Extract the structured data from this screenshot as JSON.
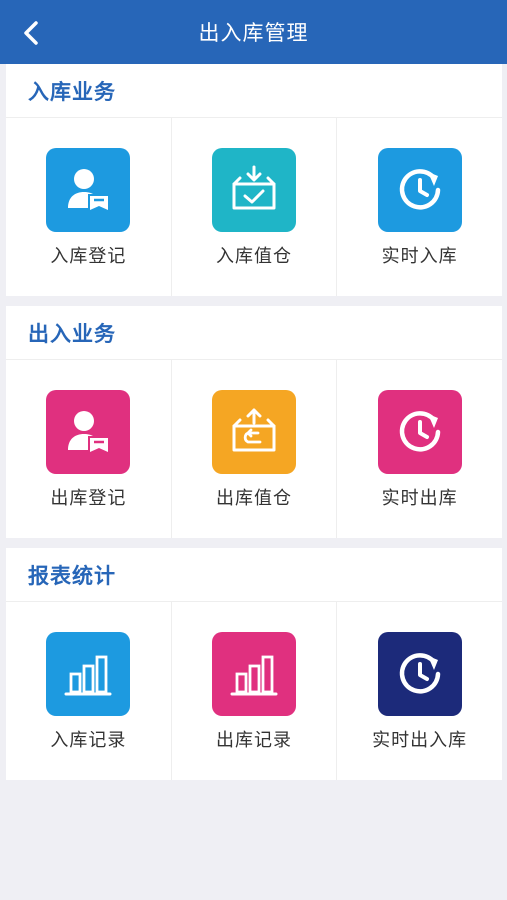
{
  "header": {
    "title": "出入库管理",
    "back_icon": "chevron-left-icon",
    "color": "#2766b8"
  },
  "sections": [
    {
      "title": "入库业务",
      "items": [
        {
          "label": "入库登记",
          "icon": "user-book-icon",
          "color": "#1d9ae0"
        },
        {
          "label": "入库值仓",
          "icon": "box-in-check-icon",
          "color": "#1fb5c7"
        },
        {
          "label": "实时入库",
          "icon": "clock-refresh-icon",
          "color": "#1d9ae0"
        }
      ]
    },
    {
      "title": "出入业务",
      "items": [
        {
          "label": "出库登记",
          "icon": "user-book-icon",
          "color": "#e0307f"
        },
        {
          "label": "出库值仓",
          "icon": "box-out-return-icon",
          "color": "#f5a623"
        },
        {
          "label": "实时出库",
          "icon": "clock-refresh-icon",
          "color": "#e0307f"
        }
      ]
    },
    {
      "title": "报表统计",
      "items": [
        {
          "label": "入库记录",
          "icon": "bar-chart-icon",
          "color": "#1d9ae0"
        },
        {
          "label": "出库记录",
          "icon": "bar-chart-icon",
          "color": "#e0307f"
        },
        {
          "label": "实时出入库",
          "icon": "clock-refresh-icon",
          "color": "#1c2a7a"
        }
      ]
    }
  ]
}
